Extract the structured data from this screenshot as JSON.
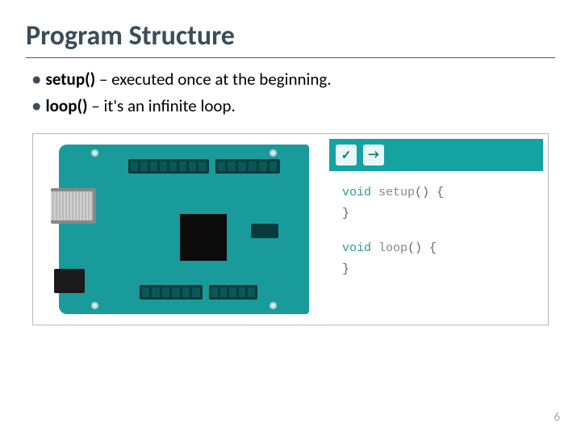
{
  "title": "Program Structure",
  "bullets": [
    {
      "bold": "setup()",
      "rest": " – executed once at the beginning."
    },
    {
      "bold": "loop()",
      "rest": " – it's an infinite loop."
    }
  ],
  "toolbar": {
    "verify_glyph": "✓",
    "upload_glyph": "→"
  },
  "code": {
    "kw": "void",
    "fn1": "setup",
    "fn2": "loop",
    "open": "() {",
    "close": "}"
  },
  "page_number": "6"
}
